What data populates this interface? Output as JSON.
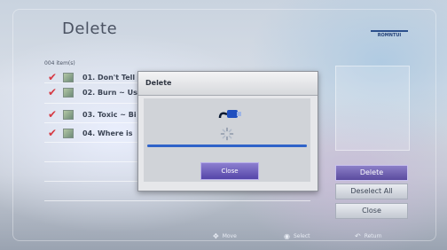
{
  "screen": {
    "title": "Delete",
    "badge": "ROMNTUI",
    "count_label": "004 item(s)"
  },
  "items": [
    {
      "label": "01. Don't Tell"
    },
    {
      "label": "02. Burn ~ Us"
    },
    {
      "label": "03. Toxic ~ Bi"
    },
    {
      "label": "04. Where is"
    }
  ],
  "side_buttons": {
    "delete": "Delete",
    "deselect_all": "Deselect All",
    "close": "Close"
  },
  "dialog": {
    "title": "Delete",
    "close_label": "Close",
    "progress": 1.0
  },
  "footer": {
    "move": "Move",
    "select": "Select",
    "return": "Return"
  },
  "colors": {
    "accent": "#5a4b9e",
    "check": "#d63a44",
    "progress": "#2f63c9"
  }
}
